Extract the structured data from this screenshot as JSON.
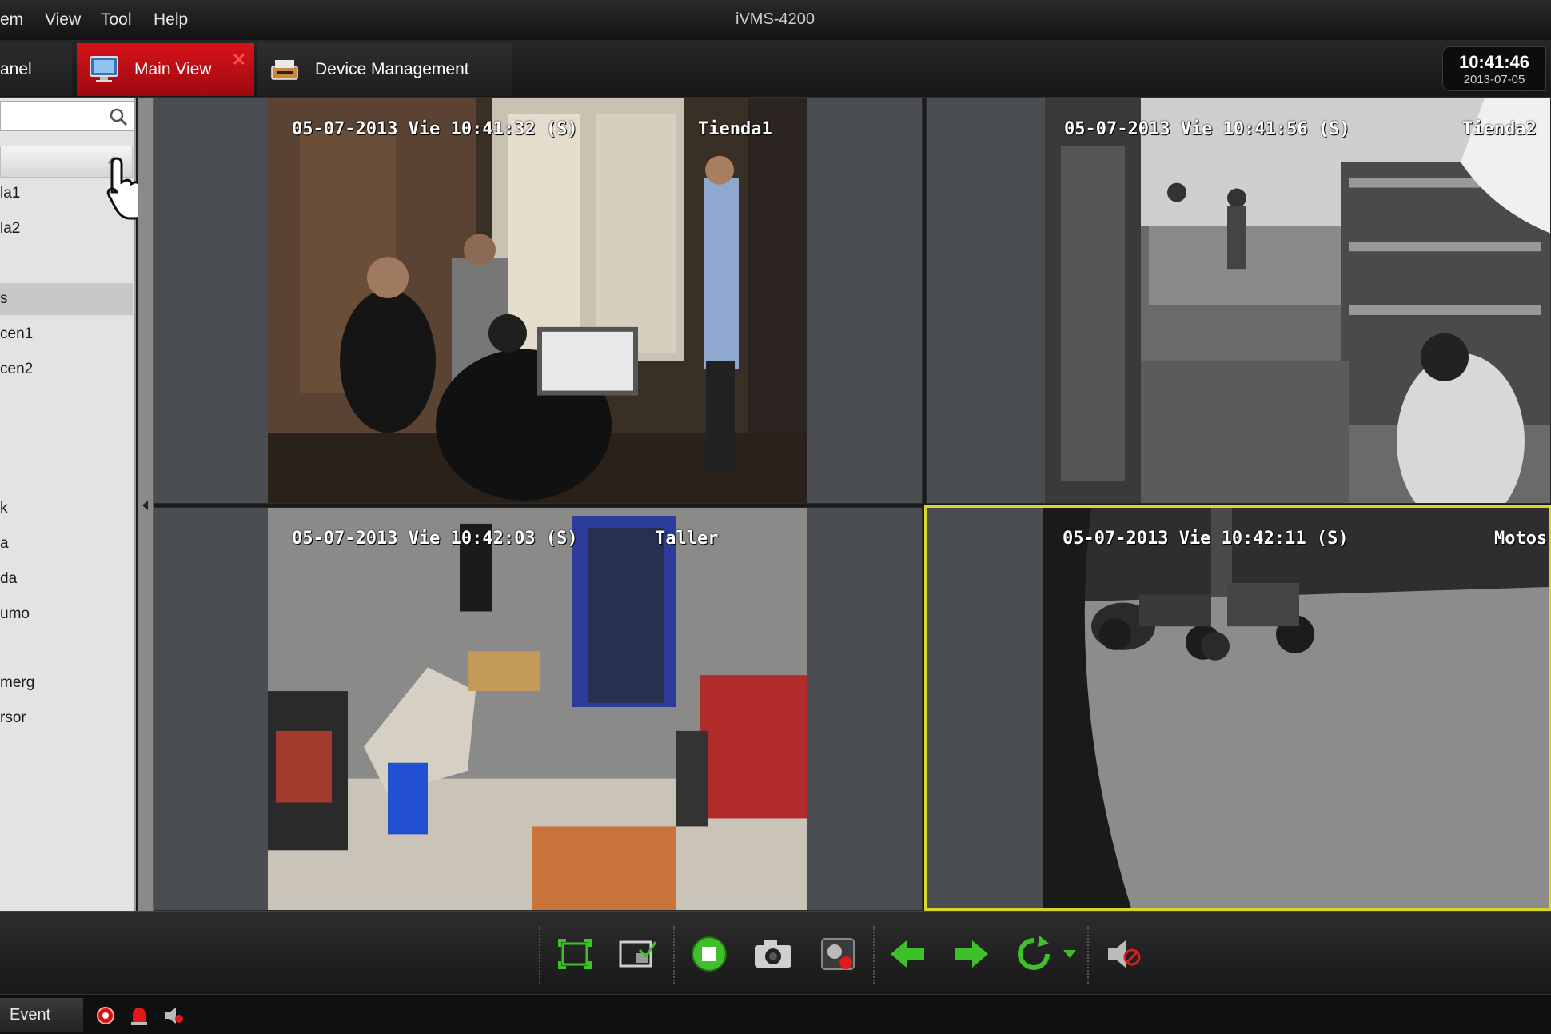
{
  "window": {
    "title": "iVMS-4200"
  },
  "menu": [
    "em",
    "View",
    "Tool",
    "Help"
  ],
  "tabs": {
    "control_panel": "anel",
    "main_view": "Main View",
    "device_management": "Device Management"
  },
  "clock": {
    "time": "10:41:46",
    "date": "2013-07-05"
  },
  "sidebar": {
    "search_value": "",
    "items": [
      "la1",
      "la2",
      "",
      "s",
      "cen1",
      "cen2",
      "k",
      "a",
      "da",
      "umo",
      "merg",
      "rsor"
    ]
  },
  "cameras": [
    {
      "timestamp": "05-07-2013 Vie 10:41:32 (S)",
      "name": "Tienda1"
    },
    {
      "timestamp": "05-07-2013 Vie 10:41:56 (S)",
      "name": "Tienda2"
    },
    {
      "timestamp": "05-07-2013 Vie 10:42:03 (S)",
      "name": "Taller"
    },
    {
      "timestamp": "05-07-2013 Vie 10:42:11 (S)",
      "name": "Motos"
    }
  ],
  "statusbar": {
    "event_label": "Event"
  },
  "colors": {
    "accent": "#d8121a",
    "selected_border": "#d7d62d",
    "ok_green": "#3fbf2a"
  }
}
